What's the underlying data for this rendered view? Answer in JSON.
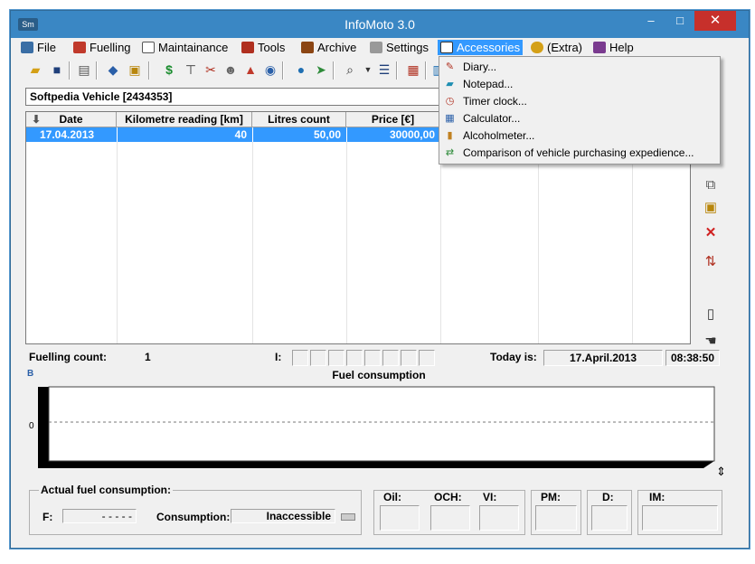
{
  "window": {
    "title": "InfoMoto 3.0",
    "app_icon_text": "Sm",
    "minimize": "–",
    "maximize": "□",
    "close": "✕"
  },
  "menu": [
    {
      "label": "File",
      "icon": "computer-icon",
      "color": "#3a6ea5"
    },
    {
      "label": "Fuelling",
      "icon": "fuel-pump-icon",
      "color": "#c0392b"
    },
    {
      "label": "Maintainance",
      "icon": "magnifier-icon",
      "color": "#555555"
    },
    {
      "label": "Tools",
      "icon": "tools-icon",
      "color": "#b03020"
    },
    {
      "label": "Archive",
      "icon": "books-icon",
      "color": "#8b4513"
    },
    {
      "label": "Settings",
      "icon": "wrench-icon",
      "color": "#777777"
    },
    {
      "label": "Accessories",
      "icon": "accessories-icon",
      "color": "#ffffff"
    },
    {
      "label": "(Extra)",
      "icon": "gear-icon",
      "color": "#d4a017"
    },
    {
      "label": "Help",
      "icon": "help-book-icon",
      "color": "#7a3b8f"
    }
  ],
  "vehicle": "Softpedia Vehicle [2434353]",
  "table": {
    "headers": [
      "Date",
      "Kilometre reading [km]",
      "Litres count",
      "Price [€]"
    ],
    "rows": [
      [
        "17.04.2013",
        "40",
        "50,00",
        "30000,00"
      ]
    ]
  },
  "status": {
    "fuelling_count_label": "Fuelling count:",
    "fuelling_count": "1",
    "i_label": "I:",
    "today_label": "Today is:",
    "today": "17.April.2013",
    "time": "08:38:50"
  },
  "chart_data": {
    "type": "line",
    "title": "Fuel consumption",
    "series": [],
    "yticks": [
      "0"
    ],
    "ylim": [
      0,
      0
    ]
  },
  "chart_badge": "B",
  "summary": {
    "actual_label": "Actual fuel consumption:",
    "f_label": "F:",
    "f_value": "- - - - -",
    "consumption_label": "Consumption:",
    "consumption_value": "Inaccessible",
    "oil": "Oil:",
    "och": "OCH:",
    "vi": "VI:",
    "pm": "PM:",
    "d": "D:",
    "im": "IM:"
  },
  "accessories_menu": [
    {
      "label": "Diary...",
      "icon": "pencil-icon"
    },
    {
      "label": "Notepad...",
      "icon": "notepad-icon"
    },
    {
      "label": "Timer clock...",
      "icon": "timer-icon"
    },
    {
      "label": "Calculator...",
      "icon": "calculator-icon"
    },
    {
      "label": "Alcoholmeter...",
      "icon": "alcoholmeter-icon"
    },
    {
      "label": "Comparison of vehicle purchasing expedience...",
      "icon": "cars-compare-icon"
    }
  ],
  "colors": {
    "titlebar": "#3a87c4",
    "selection": "#3399ff",
    "close": "#c7302b"
  }
}
